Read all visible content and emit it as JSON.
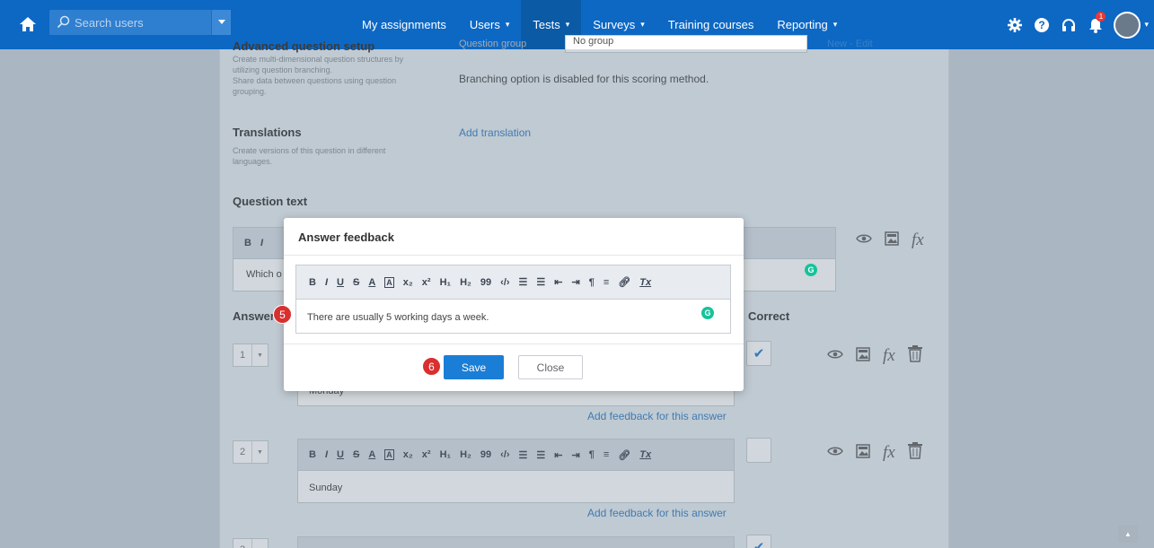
{
  "nav": {
    "search_placeholder": "Search users",
    "items": [
      {
        "label": "My assignments",
        "caret": ""
      },
      {
        "label": "Users",
        "caret": "▾"
      },
      {
        "label": "Tests",
        "caret": "▾"
      },
      {
        "label": "Surveys",
        "caret": "▾"
      },
      {
        "label": "Training courses",
        "caret": ""
      },
      {
        "label": "Reporting",
        "caret": "▾"
      }
    ],
    "active": "Tests",
    "notification_count": "1",
    "accent_color": "#0d68c4"
  },
  "page": {
    "advanced": {
      "title": "Advanced question setup",
      "desc": [
        "Create multi-dimensional question structures by",
        "utilizing question branching.",
        "Share data between questions using question",
        "grouping."
      ],
      "group_label": "Question group",
      "group_value": "No group",
      "new_edit": "New - Edit",
      "branching_note": "Branching option is disabled for this scoring method."
    },
    "translations": {
      "title": "Translations",
      "desc": [
        "Create versions of this question in different",
        "languages."
      ],
      "link": "Add translation"
    },
    "question_text": {
      "title": "Question text",
      "content": "Which o"
    },
    "answers_title": "Answers",
    "correct_title": "Correct",
    "answers": [
      {
        "num": "1",
        "text": "Monday",
        "correct": true,
        "feedback_link": "Add feedback for this answer"
      },
      {
        "num": "2",
        "text": "Sunday",
        "correct": false,
        "feedback_link": "Add feedback for this answer"
      },
      {
        "num": "3",
        "text": "",
        "correct": true,
        "feedback_link": ""
      }
    ],
    "toolbar": [
      "B",
      "I",
      "U",
      "S",
      "A",
      "A",
      "x₂",
      "x²",
      "H₁",
      "H₂",
      "99",
      "‹/›",
      "☰",
      "☰",
      "⇤",
      "⇥",
      "¶",
      "≡",
      "🔗",
      "Tx"
    ]
  },
  "modal": {
    "title": "Answer feedback",
    "text": "There are usually 5 working days a week.",
    "save": "Save",
    "close": "Close",
    "step_5": "5",
    "step_6": "6"
  }
}
